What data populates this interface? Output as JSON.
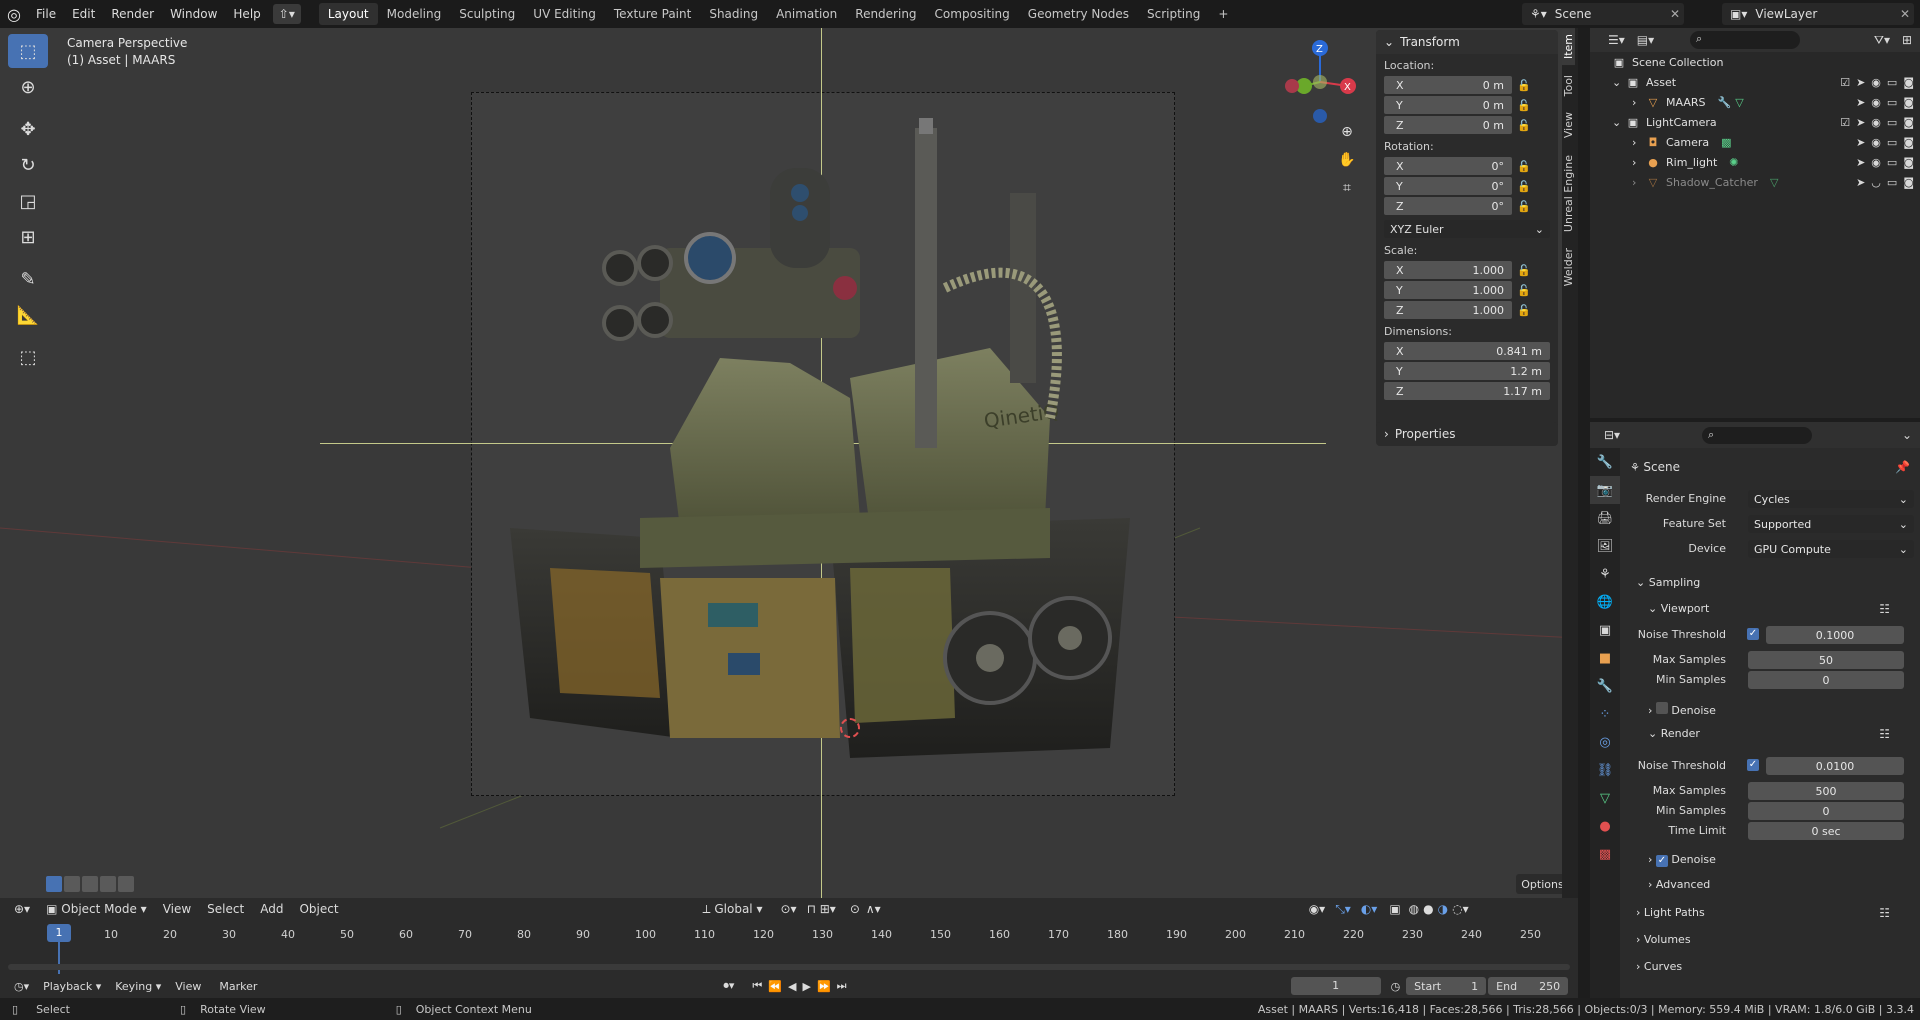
{
  "topbar": {
    "menus": [
      "File",
      "Edit",
      "Render",
      "Window",
      "Help"
    ],
    "workspaces": [
      "Layout",
      "Modeling",
      "Sculpting",
      "UV Editing",
      "Texture Paint",
      "Shading",
      "Animation",
      "Rendering",
      "Compositing",
      "Geometry Nodes",
      "Scripting"
    ],
    "active_workspace": "Layout",
    "add_tab": "+",
    "scene": "Scene",
    "view_layer": "ViewLayer"
  },
  "viewport": {
    "title": "Camera Perspective",
    "subtitle": "(1) Asset | MAARS",
    "gizmo_axes": [
      "Z",
      "X"
    ]
  },
  "npanel": {
    "tabs": [
      "Item",
      "Tool",
      "View",
      "Unreal Engine",
      "Welder"
    ],
    "transform_label": "Transform",
    "location_label": "Location:",
    "location": [
      {
        "axis": "X",
        "value": "0 m"
      },
      {
        "axis": "Y",
        "value": "0 m"
      },
      {
        "axis": "Z",
        "value": "0 m"
      }
    ],
    "rotation_label": "Rotation:",
    "rotation": [
      {
        "axis": "X",
        "value": "0°"
      },
      {
        "axis": "Y",
        "value": "0°"
      },
      {
        "axis": "Z",
        "value": "0°"
      }
    ],
    "rotation_mode": "XYZ Euler",
    "scale_label": "Scale:",
    "scale": [
      {
        "axis": "X",
        "value": "1.000"
      },
      {
        "axis": "Y",
        "value": "1.000"
      },
      {
        "axis": "Z",
        "value": "1.000"
      }
    ],
    "dimensions_label": "Dimensions:",
    "dimensions": [
      {
        "axis": "X",
        "value": "0.841 m"
      },
      {
        "axis": "Y",
        "value": "1.2 m"
      },
      {
        "axis": "Z",
        "value": "1.17 m"
      }
    ],
    "properties_label": "Properties"
  },
  "outliner": {
    "root": "Scene Collection",
    "items": [
      {
        "name": "Asset"
      },
      {
        "name": "MAARS"
      },
      {
        "name": "LightCamera"
      },
      {
        "name": "Camera"
      },
      {
        "name": "Rim_light"
      },
      {
        "name": "Shadow_Catcher"
      }
    ]
  },
  "properties": {
    "context": "Scene",
    "render_engine_label": "Render Engine",
    "render_engine": "Cycles",
    "feature_set_label": "Feature Set",
    "feature_set": "Supported",
    "device_label": "Device",
    "device": "GPU Compute",
    "sampling": "Sampling",
    "viewport": "Viewport",
    "noise_threshold_label": "Noise Threshold",
    "vp_noise_threshold": "0.1000",
    "max_samples_label": "Max Samples",
    "vp_max_samples": "50",
    "min_samples_label": "Min Samples",
    "vp_min_samples": "0",
    "denoise_label": "Denoise",
    "render": "Render",
    "r_noise_threshold": "0.0100",
    "r_max_samples": "500",
    "r_min_samples": "0",
    "time_limit_label": "Time Limit",
    "r_time_limit": "0 sec",
    "advanced": "Advanced",
    "light_paths": "Light Paths",
    "volumes": "Volumes",
    "curves": "Curves"
  },
  "vp_footer": {
    "mode": "Object Mode",
    "menus": [
      "View",
      "Select",
      "Add",
      "Object"
    ],
    "orientation": "Global",
    "options": "Options"
  },
  "timeline": {
    "ticks": [
      "10",
      "20",
      "30",
      "40",
      "50",
      "60",
      "70",
      "80",
      "90",
      "100",
      "110",
      "120",
      "130",
      "140",
      "150",
      "160",
      "170",
      "180",
      "190",
      "200",
      "210",
      "220",
      "230",
      "240",
      "250"
    ],
    "current_frame": "1",
    "menus": [
      "Playback",
      "Keying",
      "View",
      "Marker"
    ],
    "frame_field": "1",
    "start_label": "Start",
    "start": "1",
    "end_label": "End",
    "end": "250"
  },
  "statusbar": {
    "select": "Select",
    "rotate": "Rotate View",
    "context": "Object Context Menu",
    "stats": "Asset | MAARS | Verts:16,418 | Faces:28,566 | Tris:28,566 | Objects:0/3 | Memory: 559.4 MiB | VRAM: 1.8/6.0 GiB | 3.3.4"
  }
}
